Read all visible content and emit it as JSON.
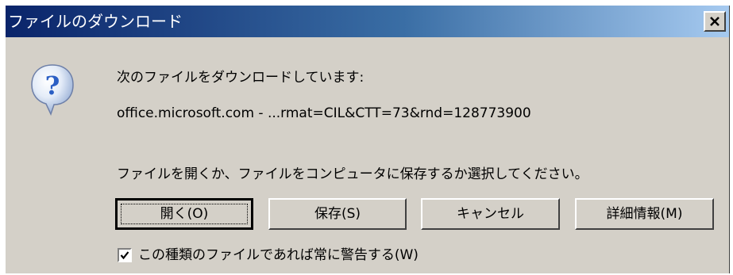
{
  "window": {
    "title": "ファイルのダウンロード",
    "close_icon": "close-x-icon",
    "title_gradient_start": "#0a246a",
    "title_gradient_end": "#a6caf0",
    "background": "#d4d0c8"
  },
  "icon": {
    "name": "question-icon",
    "color": "#2b6cd6"
  },
  "message": {
    "heading": "次のファイルをダウンロードしています:",
    "source": "office.microsoft.com - ...rmat=CIL&CTT=73&rnd=128773900",
    "instruction": "ファイルを開くか、ファイルをコンピュータに保存するか選択してください。"
  },
  "buttons": {
    "open": "開く(O)",
    "save": "保存(S)",
    "cancel": "キャンセル",
    "details": "詳細情報(M)"
  },
  "checkbox": {
    "label": "この種類のファイルであれば常に警告する(W)",
    "checked": true
  }
}
